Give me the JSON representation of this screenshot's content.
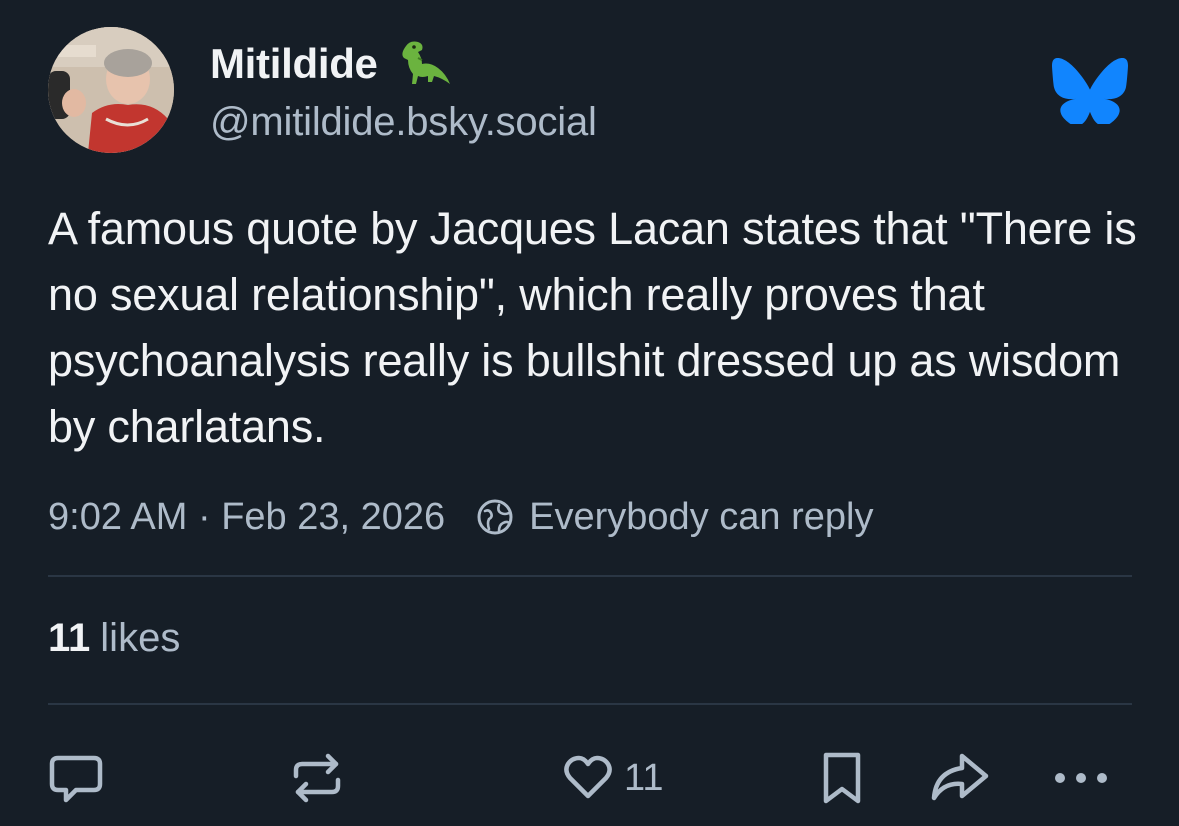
{
  "author": {
    "display_name": "Mitildide",
    "badge_icon": "t-rex-emoji-icon",
    "handle": "@mitildide.bsky.social"
  },
  "app_logo": "bluesky-butterfly-icon",
  "post": {
    "text": "A famous quote by Jacques Lacan states that \"There is no sexual relationship\", which really proves that psychoanalysis really is bullshit dressed up as wisdom by charlatans.",
    "timestamp": "9:02 AM · Feb 23, 2026",
    "reply_setting": "Everybody can reply"
  },
  "stats": {
    "likes_count": "11",
    "likes_label": "likes"
  },
  "actions": {
    "reply_icon": "reply-bubble-icon",
    "repost_icon": "repost-icon",
    "like_icon": "heart-icon",
    "like_count": "11",
    "bookmark_icon": "bookmark-icon",
    "share_icon": "share-arrow-icon",
    "more_icon": "more-dots-icon"
  },
  "colors": {
    "background": "#161e27",
    "text_primary": "#f1f3f5",
    "text_secondary": "#aebbc9",
    "divider": "#2a3644",
    "brand_blue": "#1185fe"
  }
}
